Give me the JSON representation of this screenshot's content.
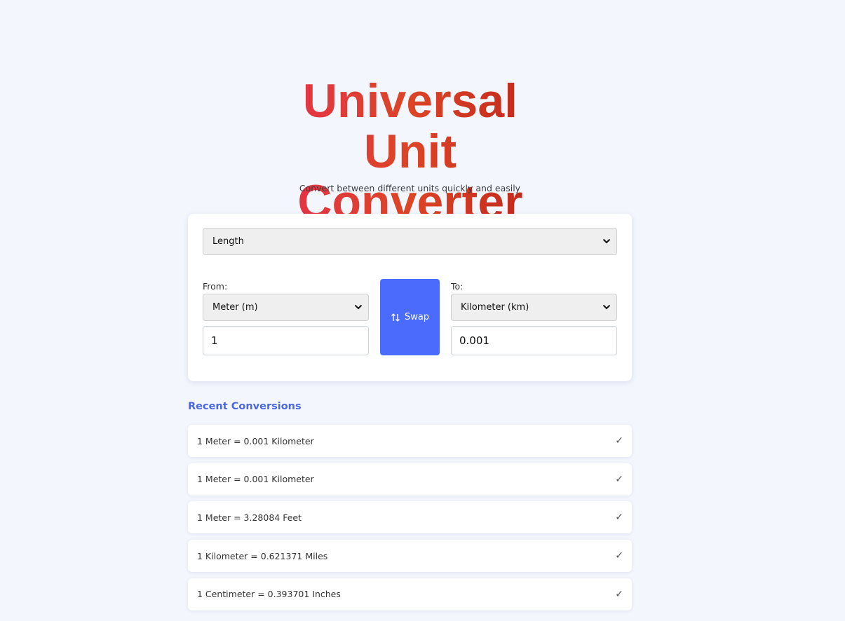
{
  "header": {
    "title": "Universal Unit Converter",
    "subtitle": "Convert between different units quickly and easily"
  },
  "converter": {
    "category": "Length",
    "from_label": "From:",
    "to_label": "To:",
    "from_unit": "Meter (m)",
    "to_unit": "Kilometer (km)",
    "from_value": "1",
    "to_value": "0.001",
    "swap_label": "Swap"
  },
  "recent": {
    "heading": "Recent Conversions",
    "items": [
      {
        "text": "1 Meter = 0.001 Kilometer",
        "mark": "✓"
      },
      {
        "text": "1 Meter = 0.001 Kilometer",
        "mark": "✓"
      },
      {
        "text": "1 Meter = 3.28084 Feet",
        "mark": "✓"
      },
      {
        "text": "1 Kilometer = 0.621371 Miles",
        "mark": "✓"
      },
      {
        "text": "1 Centimeter = 0.393701 Inches",
        "mark": "✓"
      }
    ]
  },
  "colors": {
    "background": "#f3f6fd",
    "accent": "#4a6bfb",
    "heading_blue": "#4a67e6",
    "title_gradient": [
      "#e52f50",
      "#dc4526",
      "#b9201a"
    ]
  },
  "icons": {
    "swap": "swap-vertical-arrows-icon",
    "select": "chevron-down-icon",
    "recent_item": "check-icon"
  }
}
